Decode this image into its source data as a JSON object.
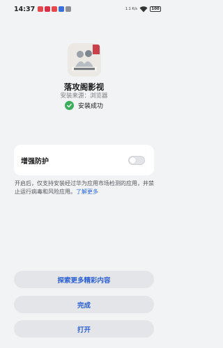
{
  "status_bar": {
    "time": "14:37",
    "network_speed": "1.1 K/s",
    "battery": "100"
  },
  "app": {
    "name": "落攻阁影视",
    "source": "安装来源：浏览器",
    "icon_name": "app-poster-icon"
  },
  "install": {
    "status": "安装成功",
    "status_color": "#3aae5a"
  },
  "protection": {
    "label": "增强防护",
    "enabled": false,
    "description": "开启后，仅支持安装经过华为应用市场检测的应用，并禁止运行病毒和风险应用。",
    "learn_more": "了解更多"
  },
  "buttons": {
    "explore": "探索更多精彩内容",
    "done": "完成",
    "open": "打开"
  },
  "colors": {
    "accent": "#2b5fd6",
    "background": "#f1f3f5"
  }
}
